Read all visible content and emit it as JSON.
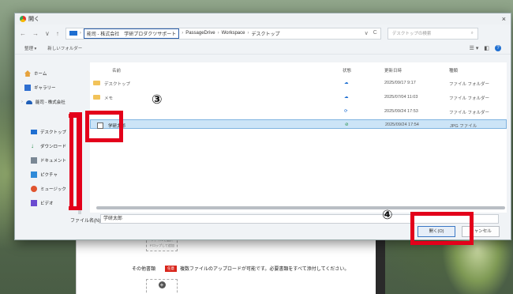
{
  "dialog": {
    "title": "開く",
    "close": "×"
  },
  "nav": {
    "back": "←",
    "forward": "→",
    "down": "∨",
    "up": "↑"
  },
  "path": {
    "segments": [
      "能司 - 株式会社　学研プロダクツサポート",
      "PassageDrive",
      "Workspace",
      "デスクトップ"
    ],
    "sep": "›",
    "dropdown": "∨",
    "refresh": "C"
  },
  "search": {
    "placeholder": "デスクトップの検索",
    "icon": "⌕"
  },
  "toolbar": {
    "organize": "整理 ▾",
    "new_folder": "新しいフォルダー",
    "view": "☰ ▾",
    "pane": "◧",
    "help": "?"
  },
  "sidebar": {
    "items": [
      {
        "label": "ホーム",
        "icon": "home-icon"
      },
      {
        "label": "ギャラリー",
        "icon": "gallery-icon"
      },
      {
        "label": "能司 - 株式会社",
        "icon": "cloud-icon"
      },
      {
        "label": "デスクトップ",
        "icon": "desktop-icon"
      },
      {
        "label": "ダウンロード",
        "icon": "download-icon"
      },
      {
        "label": "ドキュメント",
        "icon": "document-icon"
      },
      {
        "label": "ピクチャ",
        "icon": "pictures-icon"
      },
      {
        "label": "ミュージック",
        "icon": "music-icon"
      },
      {
        "label": "ビデオ",
        "icon": "video-icon"
      }
    ],
    "colors": {
      "home": "#e6a23c",
      "gallery": "#2f6fd0",
      "cloud": "#1f5fb8",
      "desktop": "#1f6fd1",
      "download": "#1f8a45",
      "document": "#7a8794",
      "pictures": "#2f8ad8",
      "music": "#e0542e",
      "video": "#6a4bd0"
    }
  },
  "columns": {
    "name": "名前",
    "status": "状態",
    "date": "更新日時",
    "type": "種類"
  },
  "files": [
    {
      "name": "デスクトップ",
      "status": "☁",
      "date": "2025/09/17 9:17",
      "type": "ファイル フォルダー"
    },
    {
      "name": "メモ",
      "status": "☁",
      "date": "2025/07/04 11:03",
      "type": "ファイル フォルダー"
    },
    {
      "name": "",
      "status": "⟳",
      "date": "2025/09/24 17:53",
      "type": "ファイル フォルダー"
    },
    {
      "name": "学研太郎",
      "status": "⊘",
      "date": "2025/09/24 17:54",
      "type": "JPG ファイル"
    }
  ],
  "filename": {
    "label": "ファイル名(N):",
    "value": "学研太郎"
  },
  "buttons": {
    "open": "開く(O)",
    "cancel": "キャンセル"
  },
  "annotations": {
    "three": "③",
    "four": "④"
  },
  "webpage": {
    "upload_text_1": "ファイルを選択",
    "upload_text_2": "ドロップして追加",
    "row_label": "その他書類",
    "badge": "任意",
    "description": "複数ファイルのアップロードが可能です。必要書類をすべて添付してください。",
    "plus": "+"
  },
  "colors": {
    "highlight": "#e3001b",
    "selected_row": "#cce4f7",
    "accent": "#1f6fd1"
  }
}
